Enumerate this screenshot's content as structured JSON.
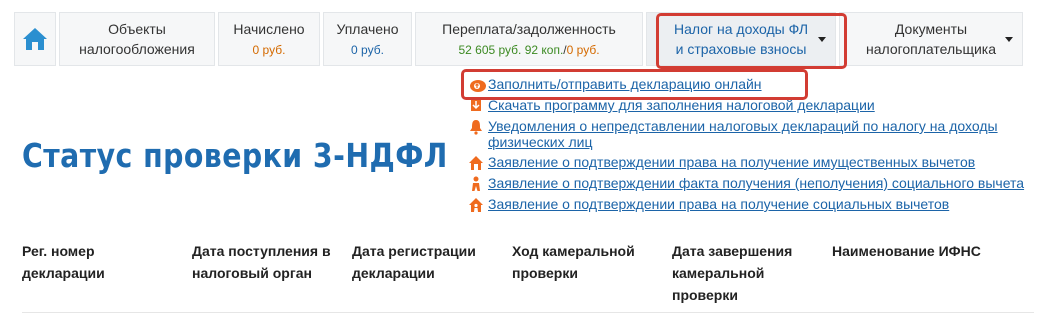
{
  "nav": {
    "home_icon": "house-icon",
    "tabs": [
      {
        "line1": "Объекты",
        "line2": "налогообложения"
      },
      {
        "label": "Начислено",
        "value": "0 руб."
      },
      {
        "label": "Уплачено",
        "value": "0 руб."
      },
      {
        "label": "Переплата/задолженность",
        "value_green": "52 605 руб. 92 коп.",
        "value_sep": "/",
        "value_orange": "0 руб."
      },
      {
        "line1": "Налог на доходы ФЛ",
        "line2": "и страховые взносы"
      },
      {
        "line1": "Документы",
        "line2": "налогоплательщика"
      }
    ]
  },
  "dropdown_links": [
    {
      "label": "Заполнить/отправить декларацию онлайн",
      "icon": "cloud-upload-icon"
    },
    {
      "label": "Скачать программу для заполнения налоговой декларации",
      "icon": "download-icon"
    },
    {
      "label": "Уведомления о непредставлении налоговых деклараций по налогу на доходы физических лиц",
      "icon": "bell-icon"
    },
    {
      "label": "Заявление о подтверждении права на получение имущественных вычетов",
      "icon": "house-icon"
    },
    {
      "label": "Заявление о подтверждении факта получения (неполучения) социального вычета",
      "icon": "person-icon"
    },
    {
      "label": "Заявление о подтверждении права на получение социальных вычетов",
      "icon": "house-person-icon"
    }
  ],
  "page_title": "Статус проверки 3-НДФЛ",
  "table": {
    "columns": [
      "Рег. номер декларации",
      "Дата поступления в налоговый орган",
      "Дата регистрации декларации",
      "Ход камеральной проверки",
      "Дата завершения камеральной проверки",
      "Наименование ИФНС"
    ]
  },
  "colors": {
    "accent_blue": "#1f6cb0",
    "link_blue": "#1c64a8",
    "highlight_red": "#d23c33",
    "orange": "#e36b00",
    "green": "#3c8a22"
  }
}
